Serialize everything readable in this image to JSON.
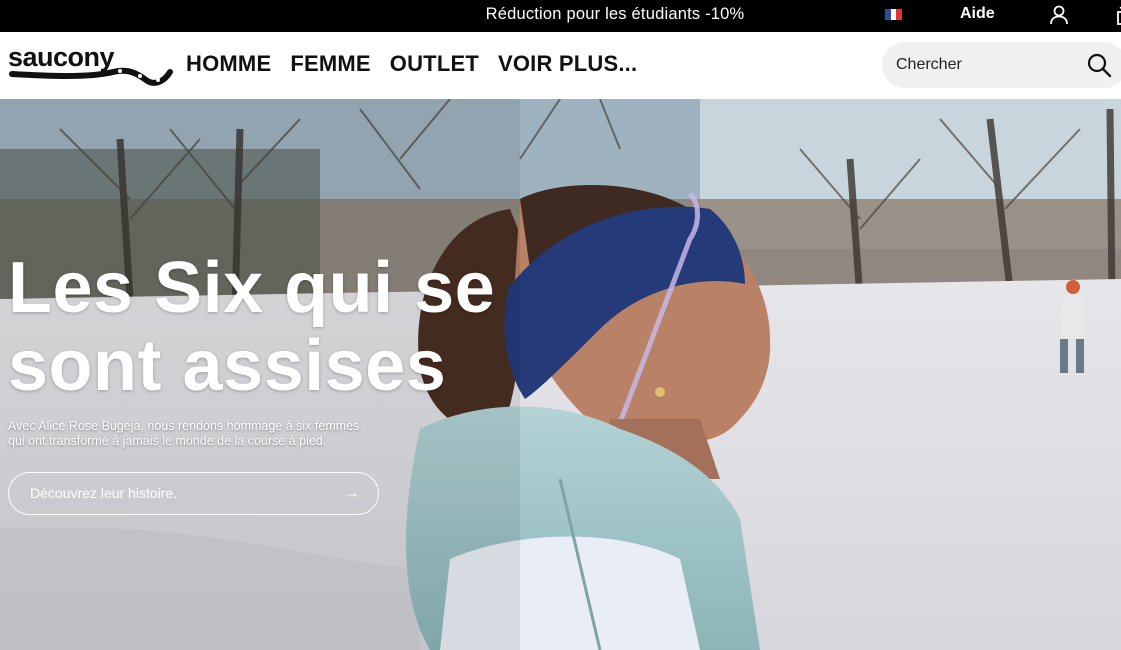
{
  "promo": {
    "text": "Réduction pour les étudiants -10%"
  },
  "header": {
    "help_label": "Aide",
    "flag_colors": [
      "#2a4ea3",
      "#ffffff",
      "#e3342f"
    ]
  },
  "brand": {
    "name": "saucony",
    "color": "#111111"
  },
  "nav": {
    "items": [
      {
        "label": "HOMME"
      },
      {
        "label": "FEMME"
      },
      {
        "label": "OUTLET"
      },
      {
        "label": "VOIR PLUS..."
      }
    ]
  },
  "search": {
    "placeholder": "Chercher",
    "value": ""
  },
  "hero": {
    "title_line1": "Les Six qui se",
    "title_line2": "sont assises",
    "subtitle_line1": "Avec Alice Rose Bugeja, nous rendons hommage à six femmes",
    "subtitle_line2": "qui ont transformé à jamais le monde de la course à pied.",
    "cta_label": "Découvrez leur histoire.",
    "cta_arrow": "→"
  },
  "icons": {
    "account": "account-icon",
    "cart": "cart-icon",
    "search": "search-icon",
    "arrow": "arrow-right-icon"
  }
}
